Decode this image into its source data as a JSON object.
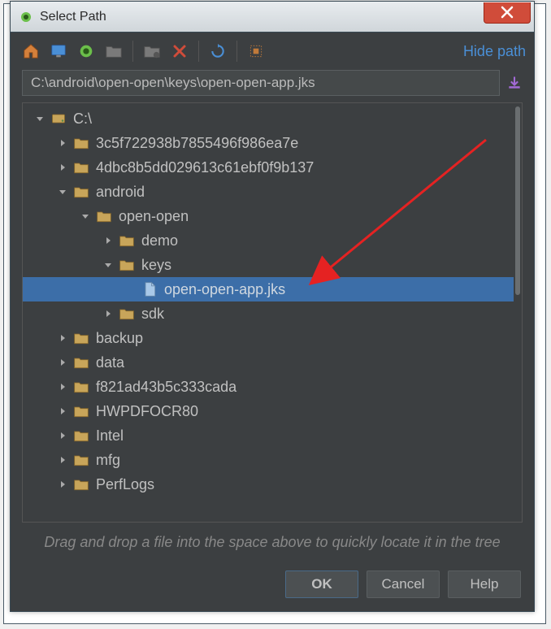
{
  "title": "Select Path",
  "toolbar": {
    "hide_path_label": "Hide path"
  },
  "path_input": {
    "value": "C:\\android\\open-open\\keys\\open-open-app.jks"
  },
  "tree": [
    {
      "depth": 0,
      "toggle": "down",
      "icon": "disk",
      "label": "C:\\",
      "selected": false
    },
    {
      "depth": 1,
      "toggle": "right",
      "icon": "folder",
      "label": "3c5f722938b7855496f986ea7e",
      "selected": false
    },
    {
      "depth": 1,
      "toggle": "right",
      "icon": "folder",
      "label": "4dbc8b5dd029613c61ebf0f9b137",
      "selected": false
    },
    {
      "depth": 1,
      "toggle": "down",
      "icon": "folder",
      "label": "android",
      "selected": false
    },
    {
      "depth": 2,
      "toggle": "down",
      "icon": "folder",
      "label": "open-open",
      "selected": false
    },
    {
      "depth": 3,
      "toggle": "right",
      "icon": "folder",
      "label": "demo",
      "selected": false
    },
    {
      "depth": 3,
      "toggle": "down",
      "icon": "folder",
      "label": "keys",
      "selected": false
    },
    {
      "depth": 4,
      "toggle": "none",
      "icon": "file",
      "label": "open-open-app.jks",
      "selected": true
    },
    {
      "depth": 3,
      "toggle": "right",
      "icon": "folder",
      "label": "sdk",
      "selected": false
    },
    {
      "depth": 1,
      "toggle": "right",
      "icon": "folder",
      "label": "backup",
      "selected": false
    },
    {
      "depth": 1,
      "toggle": "right",
      "icon": "folder",
      "label": "data",
      "selected": false
    },
    {
      "depth": 1,
      "toggle": "right",
      "icon": "folder",
      "label": "f821ad43b5c333cada",
      "selected": false
    },
    {
      "depth": 1,
      "toggle": "right",
      "icon": "folder",
      "label": "HWPDFOCR80",
      "selected": false
    },
    {
      "depth": 1,
      "toggle": "right",
      "icon": "folder",
      "label": "Intel",
      "selected": false
    },
    {
      "depth": 1,
      "toggle": "right",
      "icon": "folder",
      "label": "mfg",
      "selected": false
    },
    {
      "depth": 1,
      "toggle": "right",
      "icon": "folder",
      "label": "PerfLogs",
      "selected": false
    }
  ],
  "hint": "Drag and drop a file into the space above to quickly locate it in the tree",
  "buttons": {
    "ok": "OK",
    "cancel": "Cancel",
    "help": "Help"
  },
  "icons": {
    "home": "home-icon",
    "desktop": "desktop-icon",
    "project": "project-icon",
    "new_folder": "new-folder-icon",
    "new_folder_alt": "new-folder-alt-icon",
    "delete": "delete-icon",
    "refresh": "refresh-icon",
    "show_hidden": "show-hidden-icon",
    "download": "download-icon"
  }
}
